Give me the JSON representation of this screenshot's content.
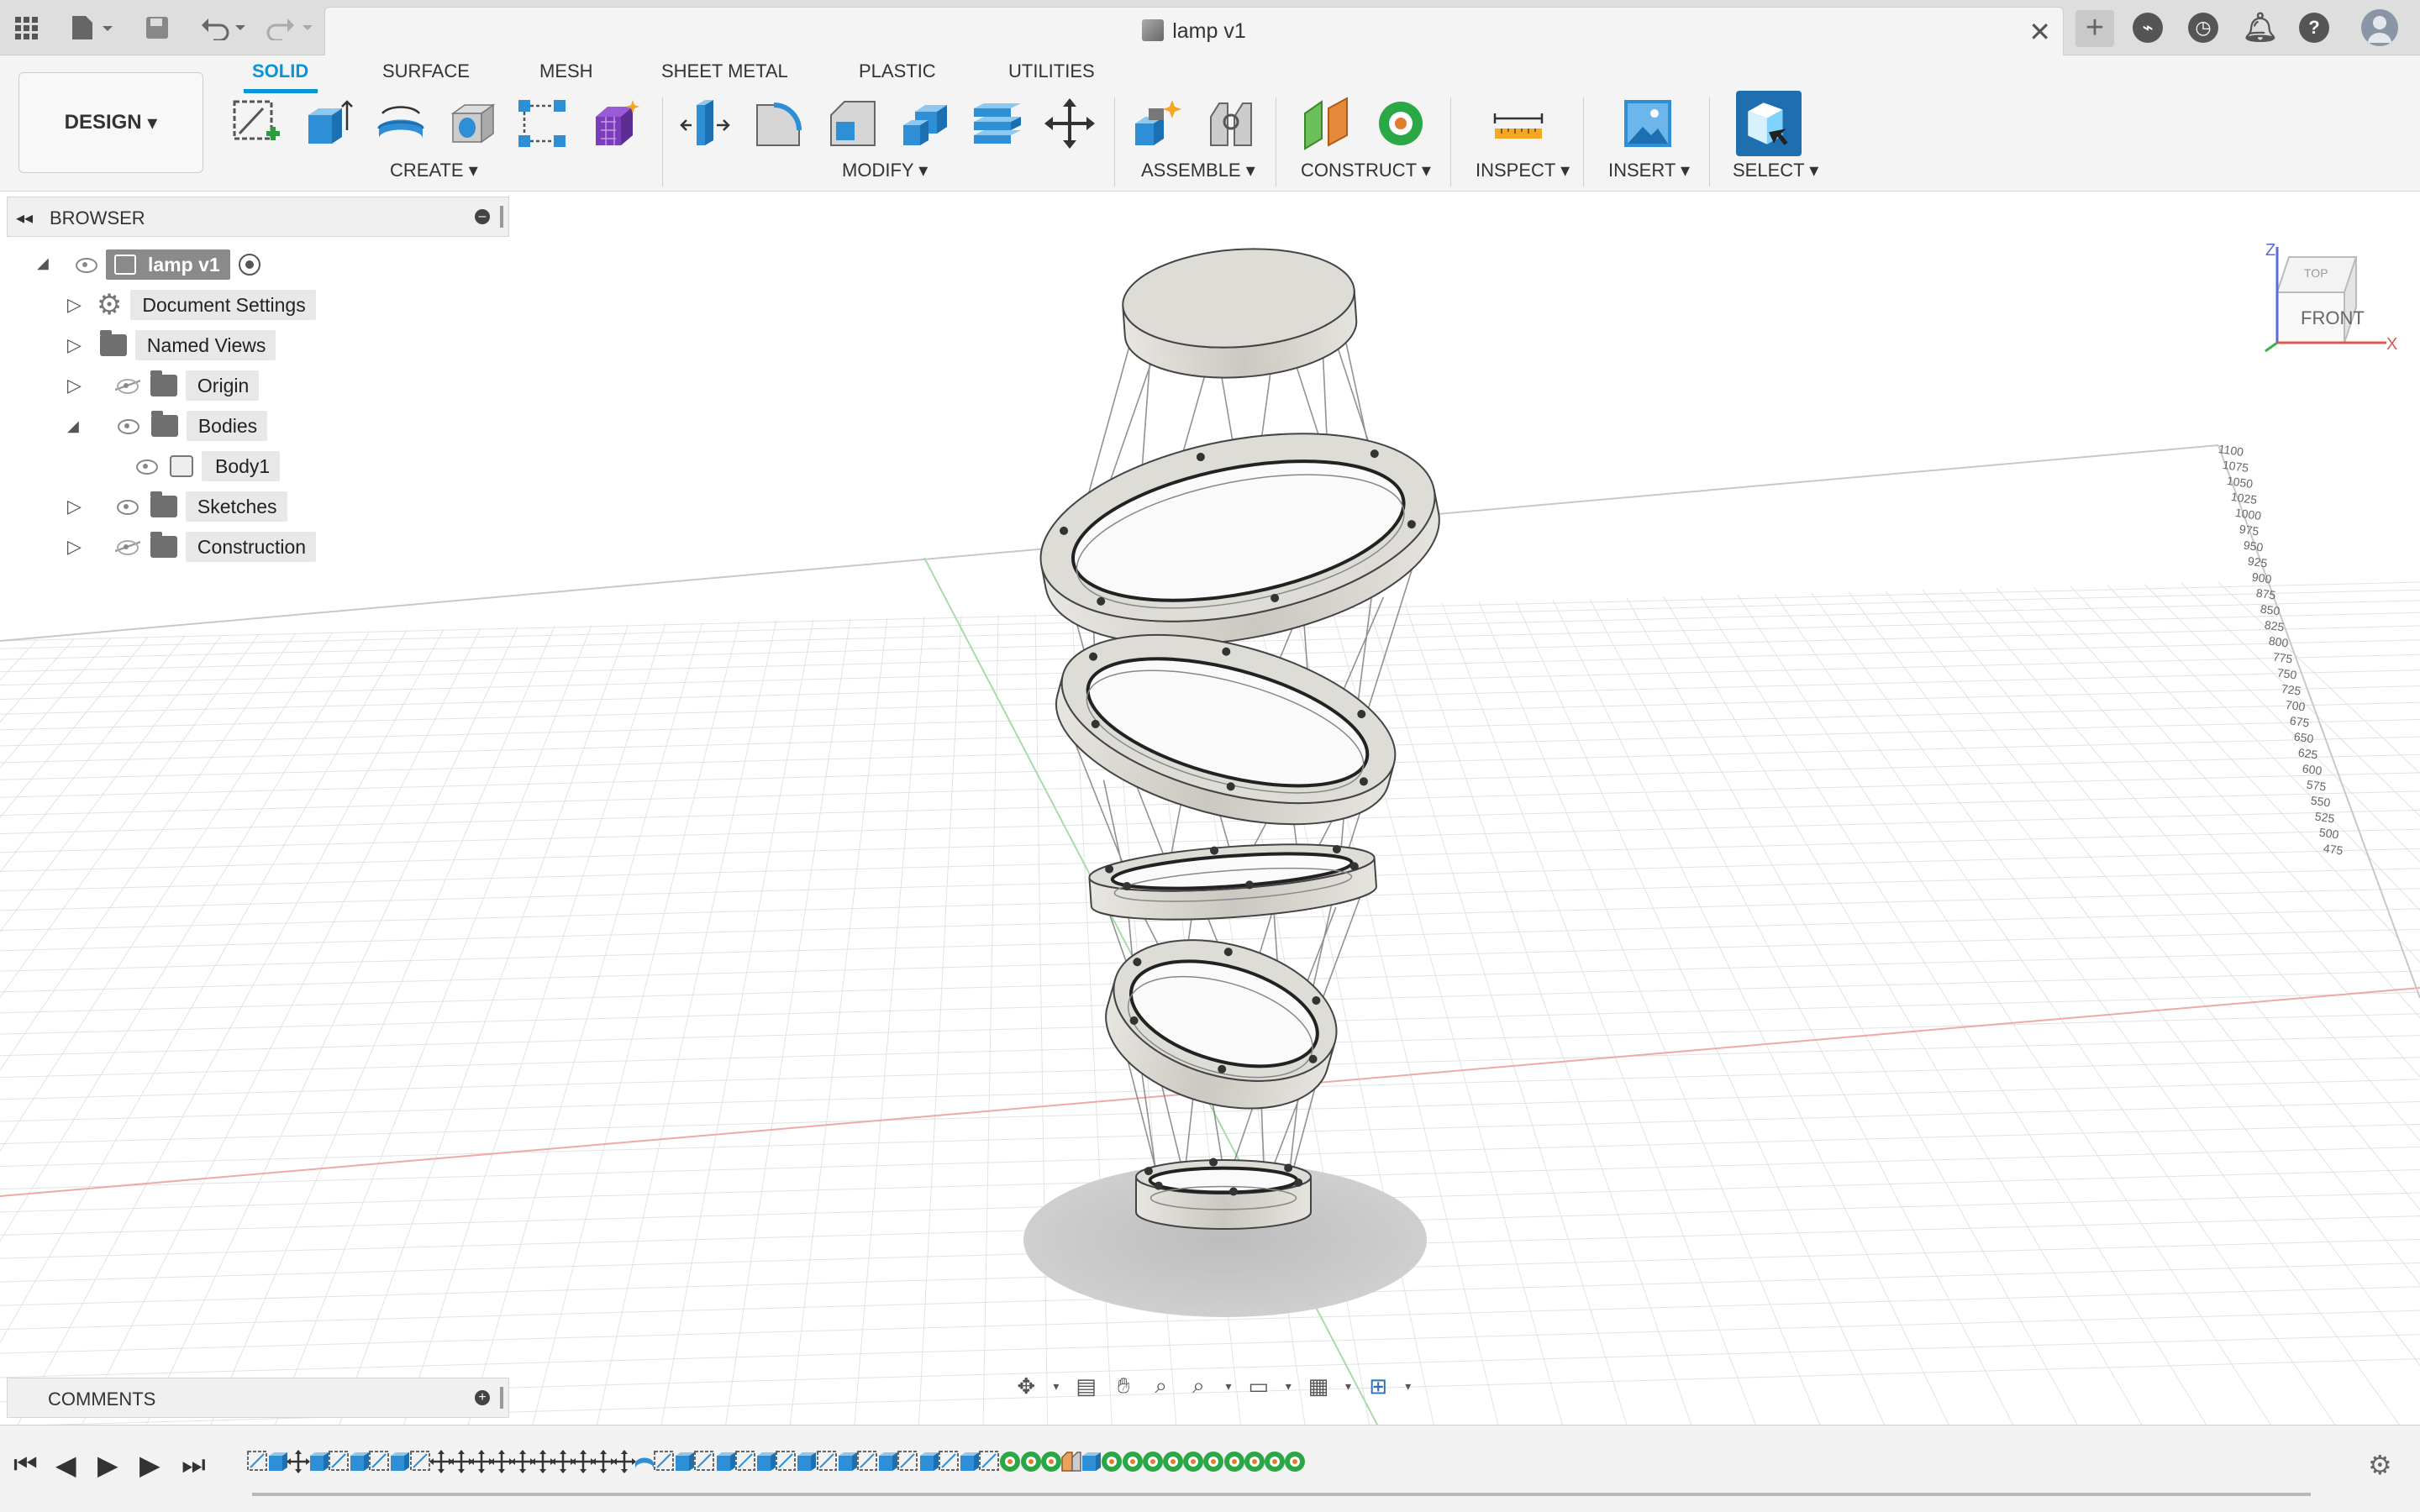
{
  "app": {
    "title": "lamp v1"
  },
  "toolbar": {
    "workspace": "DESIGN",
    "tabs": [
      "SOLID",
      "SURFACE",
      "MESH",
      "SHEET METAL",
      "PLASTIC",
      "UTILITIES"
    ],
    "groups": {
      "create": "CREATE",
      "modify": "MODIFY",
      "assemble": "ASSEMBLE",
      "construct": "CONSTRUCT",
      "inspect": "INSPECT",
      "insert": "INSERT",
      "select": "SELECT"
    }
  },
  "browser": {
    "title": "BROWSER",
    "root": "lamp v1",
    "items": {
      "document_settings": "Document Settings",
      "named_views": "Named Views",
      "origin": "Origin",
      "bodies": "Bodies",
      "body1": "Body1",
      "sketches": "Sketches",
      "construction": "Construction"
    }
  },
  "comments": {
    "title": "COMMENTS"
  },
  "viewcube": {
    "face": "FRONT",
    "axis_z": "Z",
    "axis_x": "X",
    "face_top": "TOP"
  },
  "ruler_labels": [
    "1100",
    "1075",
    "1050",
    "1025",
    "1000",
    "975",
    "950",
    "925",
    "900",
    "875",
    "850",
    "825",
    "800",
    "775",
    "750",
    "725",
    "700",
    "675",
    "650",
    "625",
    "600",
    "575",
    "550",
    "525",
    "500",
    "475"
  ],
  "colors": {
    "accent": "#0696d7",
    "body_metal": "#c8c6c0",
    "grid": "#dcdcdc"
  }
}
